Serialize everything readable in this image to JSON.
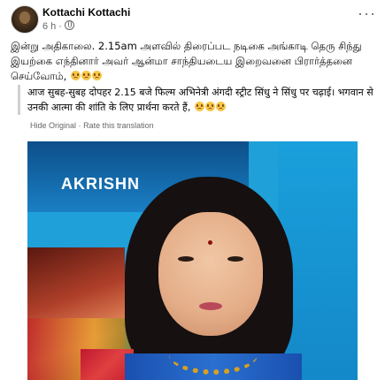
{
  "post": {
    "author": "Kottachi Kottachi",
    "time": "6 h",
    "more": "···",
    "text": "இன்று அதிகாலை. 2.15am அளவில் திரைப்பட நடிகை அங்காடி தெரு சிந்து இயற்கை எந்தினார் அவர் ஆன்மா சாந்தியடைய இறைவனை பிரார்த்தனை செய்வோம்,",
    "translation": {
      "text": "आज सुबह-सुबह दोपहर 2.15 बजे फिल्म अभिनेत्री अंगदी स्ट्रीट सिंधु ने सिंधु पर चढ़ाई। भगवान से उनकी आत्मा की शांति के लिए प्रार्थना करते हैं,",
      "hide_original": "Hide Original",
      "separator": "·",
      "rate": "Rate this translation"
    },
    "photo_text": "AKRISHN"
  },
  "icons": {
    "avatar": "profile-avatar",
    "audience": "globe-icon",
    "emoji": "crying-face-emoji"
  }
}
